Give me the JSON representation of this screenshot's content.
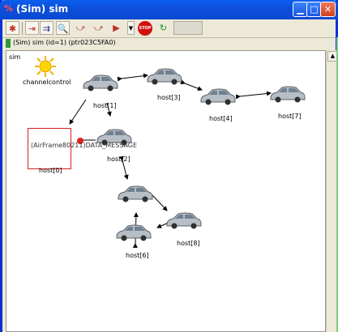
{
  "window": {
    "title": "(Sim) sim"
  },
  "toolbar": {
    "items": [
      {
        "name": "run-icon",
        "glyph": "✱"
      },
      {
        "name": "step-icon",
        "glyph": "⇥"
      },
      {
        "name": "fast-icon",
        "glyph": "⇉"
      },
      {
        "name": "inspect-icon",
        "glyph": "🔍"
      },
      {
        "name": "express-icon",
        "glyph": "⤻"
      },
      {
        "name": "until-icon",
        "glyph": "⤻"
      },
      {
        "name": "run-until-icon",
        "glyph": "▶"
      }
    ],
    "stop_label": "STOP"
  },
  "info": {
    "text": "(Sim) sim  (id=1)  (ptr023C5FA0)"
  },
  "canvas": {
    "title": "sim",
    "channelcontrol": "channelcontrol",
    "message": "(AirFrame80211)DATA_MESSAGE",
    "hosts": [
      "host[1]",
      "host[3]",
      "host[4]",
      "host[7]",
      "host[0]",
      "host[2]",
      "host[6]",
      "host[8]"
    ],
    "host5": ""
  },
  "colors": {
    "titlebar": "#0b49d1",
    "highlight": "#d42020",
    "accent_green": "#2d9a3a"
  }
}
